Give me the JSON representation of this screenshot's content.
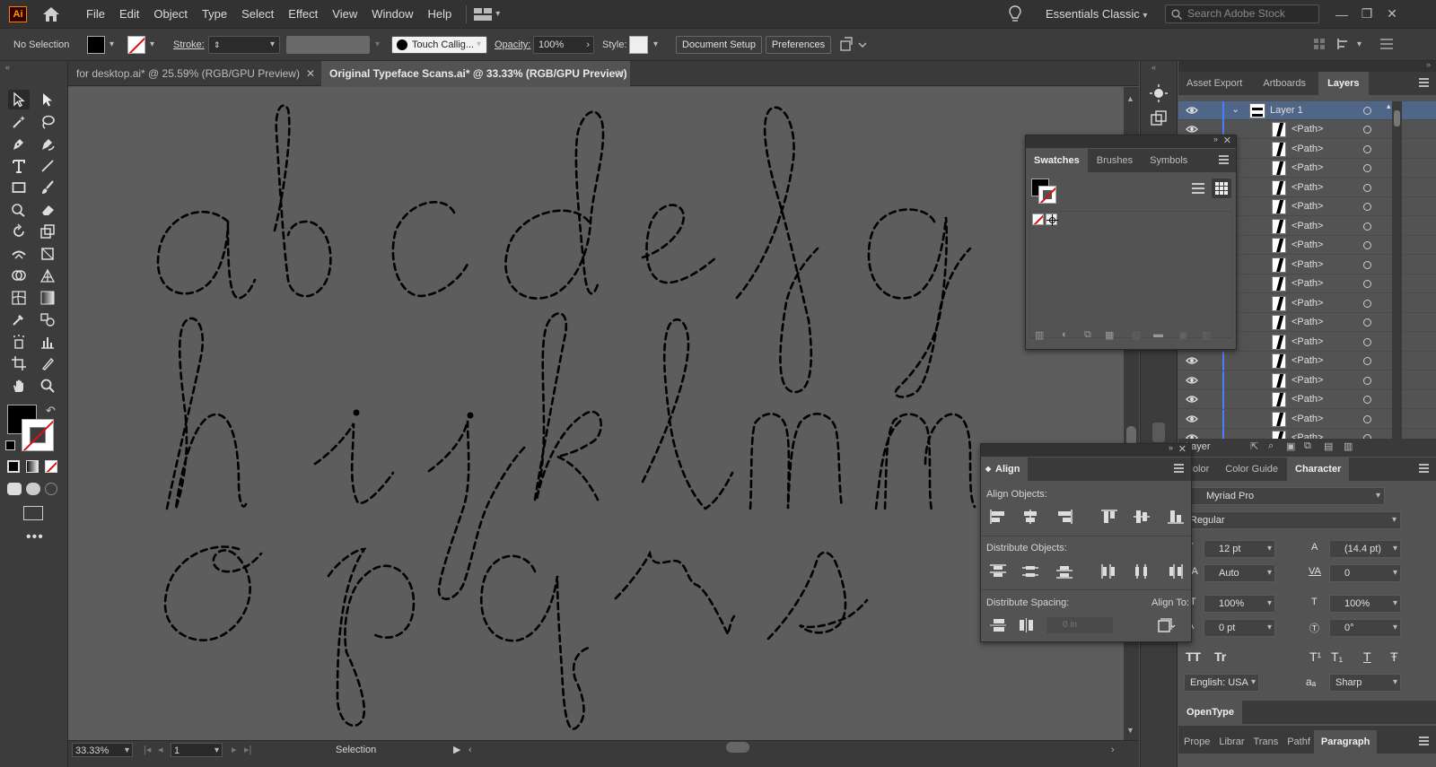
{
  "app": {
    "logo": "Ai"
  },
  "menu": [
    "File",
    "Edit",
    "Object",
    "Type",
    "Select",
    "Effect",
    "View",
    "Window",
    "Help"
  ],
  "workspace": "Essentials Classic",
  "stock_search": {
    "placeholder": "Search Adobe Stock"
  },
  "control": {
    "selection": "No Selection",
    "stroke_label": "Stroke:",
    "brush": "Touch Callig...",
    "opacity_label": "Opacity:",
    "opacity_value": "100%",
    "style_label": "Style:",
    "document_setup": "Document Setup",
    "preferences": "Preferences"
  },
  "tabs": [
    {
      "title": "for desktop.ai* @ 25.59% (RGB/GPU Preview)",
      "close": "✕"
    },
    {
      "title": "Original Typeface Scans.ai* @ 33.33% (RGB/GPU Preview)",
      "close": "✕"
    }
  ],
  "canvas": {
    "letters": [
      "a",
      "b",
      "c",
      "d",
      "e",
      "f",
      "g",
      "h",
      "i",
      "j",
      "k",
      "l",
      "m",
      "n",
      "o",
      "p",
      "q",
      "r",
      "s"
    ]
  },
  "status": {
    "zoom": "33.33%",
    "artboard": "1",
    "tool": "Selection"
  },
  "layers_panel": {
    "tabs": [
      "Asset Export",
      "Artboards",
      "Layers"
    ],
    "layer_name": "Layer 1",
    "path_label": "<Path>",
    "path_count": 17,
    "footer_label": "Layer"
  },
  "swatches_panel": {
    "tabs": [
      "Swatches",
      "Brushes",
      "Symbols"
    ]
  },
  "align_panel": {
    "title": "Align",
    "align_objects": "Align Objects:",
    "distribute_objects": "Distribute Objects:",
    "distribute_spacing": "Distribute Spacing:",
    "align_to": "Align To:",
    "spacing_value": "0 in"
  },
  "character_panel": {
    "tabs": [
      "Color",
      "Color Guide",
      "Character"
    ],
    "font": "Myriad Pro",
    "style": "Regular",
    "size": "12 pt",
    "leading": "(14.4 pt)",
    "kerning": "Auto",
    "tracking": "0",
    "vscale": "100%",
    "hscale": "100%",
    "baseline": "0 pt",
    "rotation": "0°",
    "language": "English: USA",
    "antialias": "Sharp",
    "tt1": "TT",
    "tt2": "Tr",
    "tt3": "T¹",
    "tt4": "T₁",
    "tt5": "T",
    "tt6": "Ŧ",
    "aa": "aₐ"
  },
  "bottom_tabs": {
    "opentype": "OpenType",
    "row": [
      "Prope",
      "Librar",
      "Trans",
      "Pathf",
      "Paragraph"
    ]
  },
  "colors": {
    "accent": "#4b7bff",
    "canvas": "#5d5d5d",
    "ui": "#3c3c3c"
  }
}
